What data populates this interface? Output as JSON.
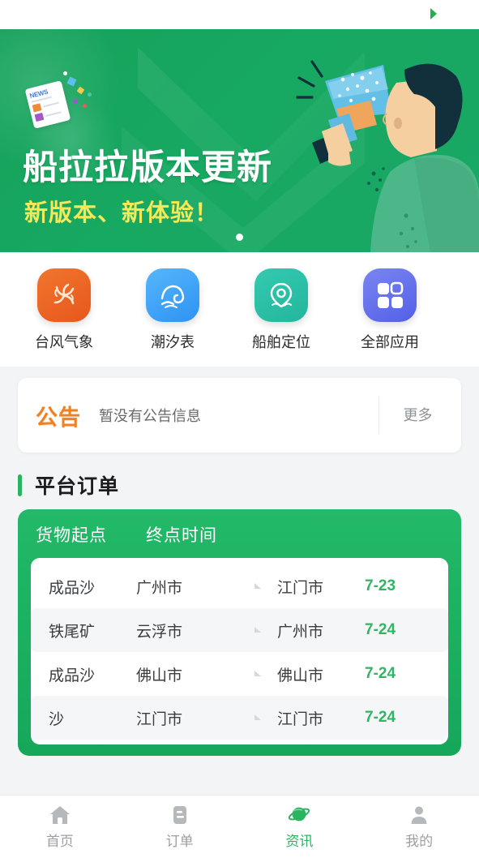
{
  "status": {
    "marker_icon": "play-triangle-icon"
  },
  "banner": {
    "title": "船拉拉版本更新",
    "subtitle": "新版本、新体验！",
    "news_badge": "NEWS",
    "pagination": [
      "dot-1"
    ],
    "bg_color": "#17a861",
    "title_color": "#ffffff",
    "subtitle_color": "#f3e959",
    "illustration": "person-with-megaphone-illustration"
  },
  "apps": [
    {
      "label": "台风气象",
      "icon": "typhoon-icon",
      "color": "#e8561e"
    },
    {
      "label": "潮汐表",
      "icon": "wave-icon",
      "color": "#2e93f3"
    },
    {
      "label": "船舶定位",
      "icon": "location-pin-icon",
      "color": "#23b69c"
    },
    {
      "label": "全部应用",
      "icon": "grid-apps-icon",
      "color": "#5360e6"
    }
  ],
  "notice": {
    "badge": "公告",
    "text": "暂没有公告信息",
    "more_label": "更多",
    "badge_color": "#f08022"
  },
  "section": {
    "title": "平台订单",
    "accent_color": "#2bb45f"
  },
  "orders": {
    "headers": [
      "货物起点",
      "终点时间"
    ],
    "rows": [
      {
        "goods": "成品沙",
        "from": "广州市",
        "to": "江门市",
        "date": "7-23"
      },
      {
        "goods": "铁尾矿",
        "from": "云浮市",
        "to": "广州市",
        "date": "7-24"
      },
      {
        "goods": "成品沙",
        "from": "佛山市",
        "to": "佛山市",
        "date": "7-24"
      },
      {
        "goods": "沙",
        "from": "江门市",
        "to": "江门市",
        "date": "7-24"
      }
    ],
    "arrow_icon": "arrow-right-icon",
    "date_color": "#2fb563",
    "card_color": "#19ac5e"
  },
  "tabbar": {
    "items": [
      {
        "label": "首页",
        "icon": "home-icon",
        "active": false
      },
      {
        "label": "订单",
        "icon": "order-list-icon",
        "active": false
      },
      {
        "label": "资讯",
        "icon": "planet-news-icon",
        "active": true
      },
      {
        "label": "我的",
        "icon": "person-icon",
        "active": false
      }
    ],
    "active_color": "#2bb45f",
    "inactive_color": "#9b9fa3"
  }
}
